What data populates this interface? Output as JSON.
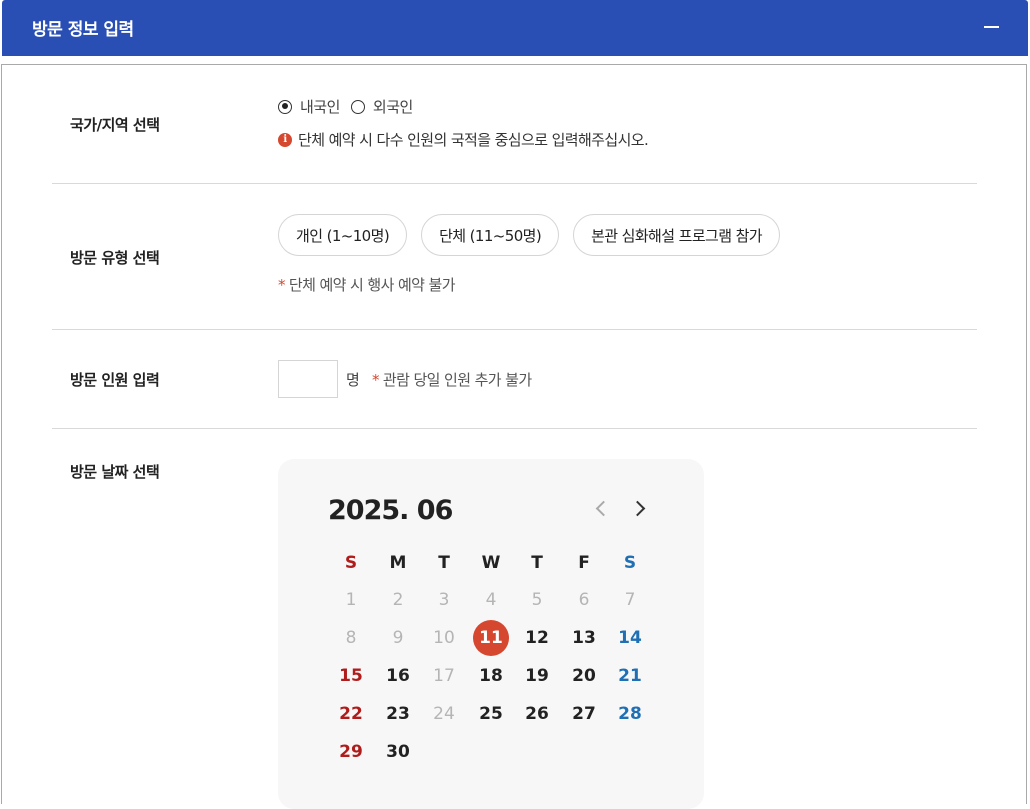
{
  "header": {
    "title": "방문 정보 입력"
  },
  "country": {
    "label": "국가/지역 선택",
    "options": [
      "내국인",
      "외국인"
    ],
    "selected": "내국인",
    "notice": "단체 예약 시 다수 인원의 국적을 중심으로 입력해주십시오."
  },
  "visit_type": {
    "label": "방문 유형 선택",
    "options": [
      "개인 (1~10명)",
      "단체 (11~50명)",
      "본관 심화해설 프로그램 참가"
    ],
    "note": "단체 예약 시 행사 예약 불가"
  },
  "headcount": {
    "label": "방문 인원 입력",
    "value": "",
    "unit": "명",
    "note": "관람 당일 인원 추가 불가"
  },
  "date": {
    "label": "방문 날짜 선택",
    "calendar": {
      "title": "2025. 06",
      "weekdays": [
        "S",
        "M",
        "T",
        "W",
        "T",
        "F",
        "S"
      ],
      "selected_day": 11,
      "weeks": [
        [
          {
            "d": "1",
            "s": "dis"
          },
          {
            "d": "2",
            "s": "dis"
          },
          {
            "d": "3",
            "s": "dis"
          },
          {
            "d": "4",
            "s": "dis"
          },
          {
            "d": "5",
            "s": "dis"
          },
          {
            "d": "6",
            "s": "dis"
          },
          {
            "d": "7",
            "s": "dis"
          }
        ],
        [
          {
            "d": "8",
            "s": "dis"
          },
          {
            "d": "9",
            "s": "dis"
          },
          {
            "d": "10",
            "s": "dis"
          },
          {
            "d": "11",
            "s": "sel"
          },
          {
            "d": "12",
            "s": "norm"
          },
          {
            "d": "13",
            "s": "norm"
          },
          {
            "d": "14",
            "s": "sat"
          }
        ],
        [
          {
            "d": "15",
            "s": "sun"
          },
          {
            "d": "16",
            "s": "norm"
          },
          {
            "d": "17",
            "s": "dis"
          },
          {
            "d": "18",
            "s": "norm"
          },
          {
            "d": "19",
            "s": "norm"
          },
          {
            "d": "20",
            "s": "norm"
          },
          {
            "d": "21",
            "s": "sat"
          }
        ],
        [
          {
            "d": "22",
            "s": "sun"
          },
          {
            "d": "23",
            "s": "norm"
          },
          {
            "d": "24",
            "s": "dis"
          },
          {
            "d": "25",
            "s": "norm"
          },
          {
            "d": "26",
            "s": "norm"
          },
          {
            "d": "27",
            "s": "norm"
          },
          {
            "d": "28",
            "s": "sat"
          }
        ],
        [
          {
            "d": "29",
            "s": "sun"
          },
          {
            "d": "30",
            "s": "norm"
          }
        ]
      ]
    }
  },
  "colors": {
    "header": "#2a4fb4",
    "accent": "#d6472f",
    "sunday": "#b01c1c",
    "saturday": "#1f6fb5"
  },
  "icons": {
    "collapse": "minus-icon",
    "notice": "info-icon",
    "prev": "chevron-left-icon",
    "next": "chevron-right-icon"
  }
}
